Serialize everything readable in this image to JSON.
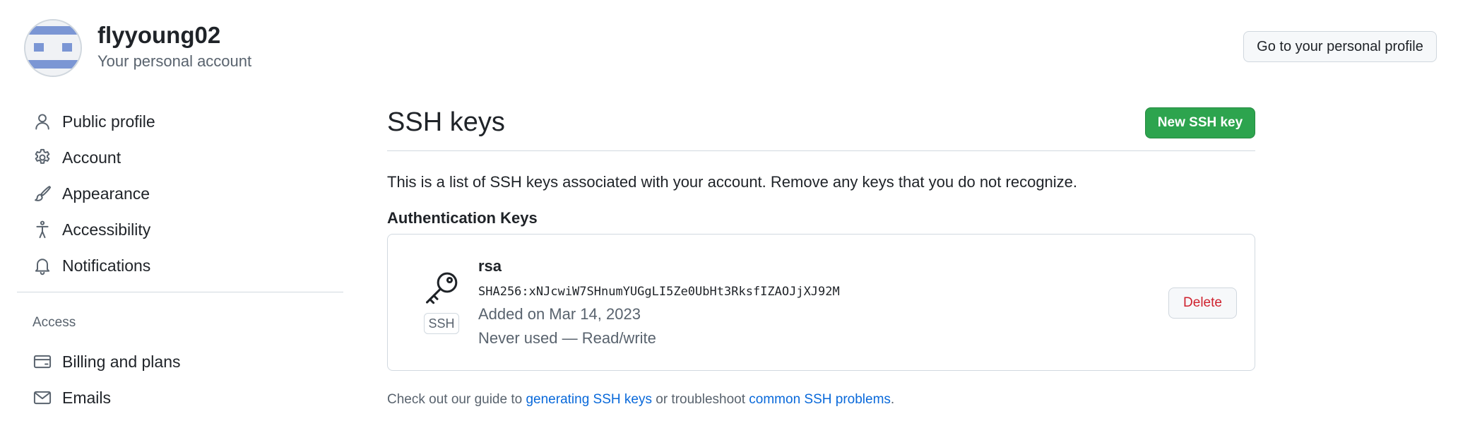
{
  "account": {
    "username": "flyyoung02",
    "subtitle": "Your personal account",
    "profile_button": "Go to your personal profile"
  },
  "sidebar": {
    "items": [
      {
        "label": "Public profile",
        "icon": "person-icon"
      },
      {
        "label": "Account",
        "icon": "gear-icon"
      },
      {
        "label": "Appearance",
        "icon": "paintbrush-icon"
      },
      {
        "label": "Accessibility",
        "icon": "accessibility-icon"
      },
      {
        "label": "Notifications",
        "icon": "bell-icon"
      }
    ],
    "access_heading": "Access",
    "access_items": [
      {
        "label": "Billing and plans",
        "icon": "credit-card-icon"
      },
      {
        "label": "Emails",
        "icon": "mail-icon"
      }
    ]
  },
  "main": {
    "title": "SSH keys",
    "new_button": "New SSH key",
    "intro": "This is a list of SSH keys associated with your account. Remove any keys that you do not recognize.",
    "section_heading": "Authentication Keys",
    "keys": [
      {
        "title": "rsa",
        "fingerprint": "SHA256:xNJcwiW7SHnumYUGgLI5Ze0UbHt3RksfIZAOJjXJ92M",
        "added": "Added on Mar 14, 2023",
        "usage": "Never used — Read/write",
        "badge": "SSH",
        "icon": "key-icon",
        "delete_label": "Delete"
      }
    ],
    "footer": {
      "prefix": "Check out our guide to ",
      "link1": "generating SSH keys",
      "middle": " or troubleshoot ",
      "link2": "common SSH problems",
      "suffix": "."
    }
  },
  "colors": {
    "primary_button": "#2da44e",
    "danger_text": "#cf222e",
    "link": "#0969da",
    "avatar_accent": "#7b96d4"
  }
}
